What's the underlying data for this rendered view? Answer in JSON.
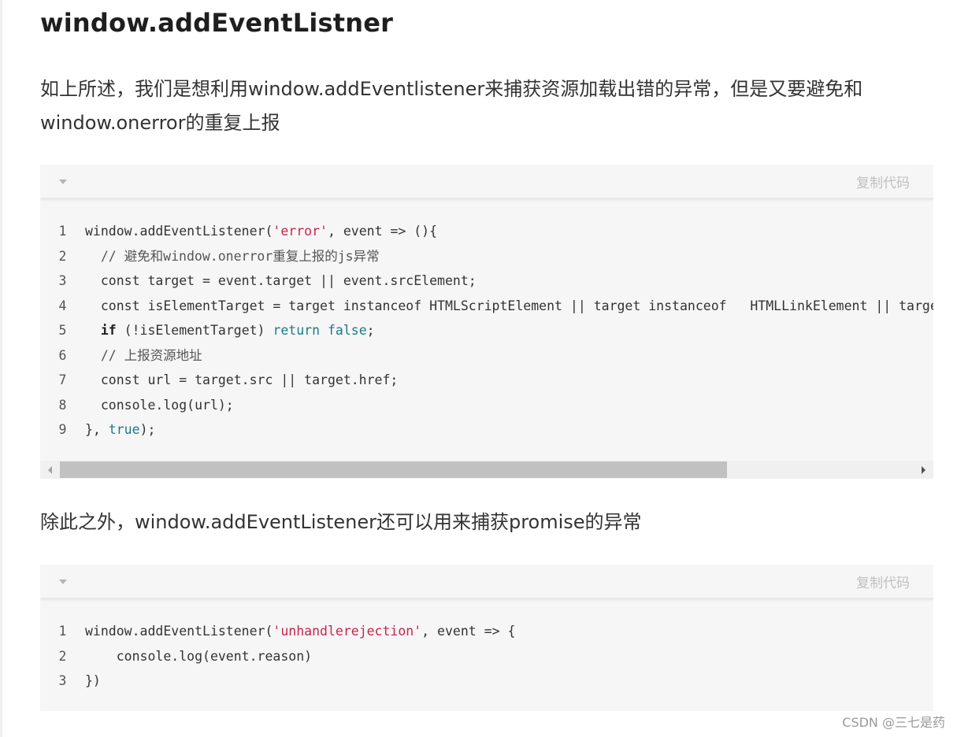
{
  "article": {
    "heading": "window.addEventListner",
    "para1": "如上所述，我们是想利用window.addEventlistener来捕获资源加载出错的异常，但是又要避免和window.onerror的重复上报",
    "para2": "除此之外，window.addEventListener还可以用来捕获promise的异常"
  },
  "code_blocks": [
    {
      "copy_label": "复制代码",
      "lines": [
        [
          {
            "t": "window.addEventListener("
          },
          {
            "t": "'error'",
            "c": "str"
          },
          {
            "t": ", event => (){"
          }
        ],
        [
          {
            "t": "  // 避免和window.onerror重复上报的js异常",
            "c": "cm"
          }
        ],
        [
          {
            "t": "  const target = event.target || event.srcElement;"
          }
        ],
        [
          {
            "t": "  const isElementTarget = target instanceof HTMLScriptElement || target instanceof   HTMLLinkElement || target instanceof HTMLImageElement;"
          }
        ],
        [
          {
            "t": "  "
          },
          {
            "t": "if",
            "c": "kwb"
          },
          {
            "t": " (!isElementTarget) "
          },
          {
            "t": "return",
            "c": "lit"
          },
          {
            "t": " "
          },
          {
            "t": "false",
            "c": "lit"
          },
          {
            "t": ";"
          }
        ],
        [
          {
            "t": "  // 上报资源地址",
            "c": "cm"
          }
        ],
        [
          {
            "t": "  const url = target.src || target.href;"
          }
        ],
        [
          {
            "t": "  console.log(url);"
          }
        ],
        [
          {
            "t": "}, "
          },
          {
            "t": "true",
            "c": "lit"
          },
          {
            "t": ");"
          }
        ]
      ],
      "scrollbar": {
        "visible_fraction": 0.76,
        "position": 0
      }
    },
    {
      "copy_label": "复制代码",
      "lines": [
        [
          {
            "t": "window.addEventListener("
          },
          {
            "t": "'unhandlerejection'",
            "c": "str"
          },
          {
            "t": ", event => {"
          }
        ],
        [
          {
            "t": "    console.log(event.reason)"
          }
        ],
        [
          {
            "t": "})"
          }
        ]
      ]
    }
  ],
  "watermark": "CSDN @三七是药",
  "colors": {
    "string": "#c7254e",
    "literal": "#1a7a8a",
    "code_bg": "#f6f6f6"
  },
  "icons": {
    "fold": "caret-down-icon",
    "scroll_left": "arrow-left-icon",
    "scroll_right": "arrow-right-icon"
  }
}
